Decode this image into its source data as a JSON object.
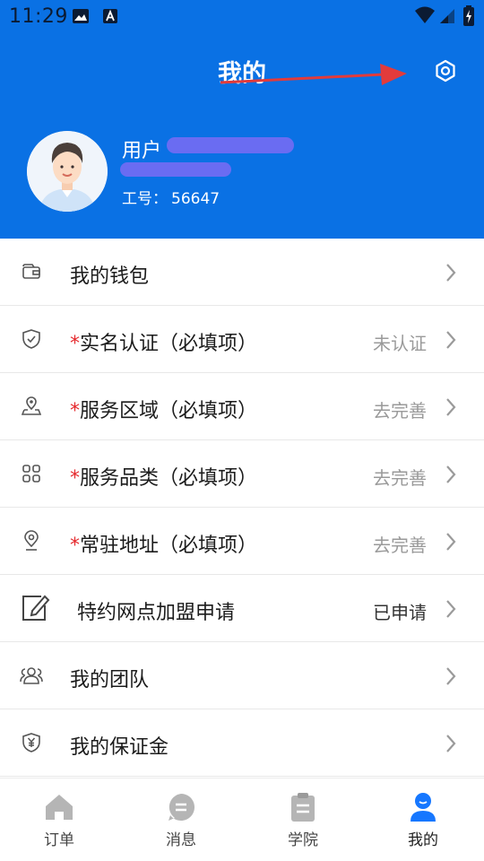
{
  "status_bar": {
    "time": "11:29"
  },
  "header": {
    "title": "我的"
  },
  "profile": {
    "name_prefix": "用户",
    "staff_id_label": "工号：",
    "staff_id": "56647"
  },
  "menu": {
    "required_mark": "*",
    "items": [
      {
        "label": "我的钱包",
        "required": false,
        "status": "",
        "icon": "wallet-icon"
      },
      {
        "label": "实名认证（必填项）",
        "required": true,
        "status": "未认证",
        "icon": "shield-check-icon"
      },
      {
        "label": "服务区域（必填项）",
        "required": true,
        "status": "去完善",
        "icon": "map-pin-area-icon"
      },
      {
        "label": "服务品类（必填项）",
        "required": true,
        "status": "去完善",
        "icon": "category-grid-icon"
      },
      {
        "label": "常驻地址（必填项）",
        "required": true,
        "status": "去完善",
        "icon": "location-pin-icon"
      },
      {
        "label": "特约网点加盟申请",
        "required": false,
        "status": "已申请",
        "icon": "edit-form-icon"
      },
      {
        "label": "我的团队",
        "required": false,
        "status": "",
        "icon": "team-icon"
      },
      {
        "label": "我的保证金",
        "required": false,
        "status": "",
        "icon": "deposit-shield-icon"
      }
    ]
  },
  "tabbar": {
    "tabs": [
      {
        "label": "订单",
        "icon": "home-icon",
        "active": false
      },
      {
        "label": "消息",
        "icon": "message-icon",
        "active": false
      },
      {
        "label": "学院",
        "icon": "clipboard-icon",
        "active": false
      },
      {
        "label": "我的",
        "icon": "user-icon",
        "active": true
      }
    ]
  },
  "colors": {
    "header_blue": "#0a71e4",
    "required_red": "#e5282c",
    "status_gray": "#9a9a9a",
    "active_tab_blue": "#1677ff",
    "inactive_tab_gray": "#b5b5b5",
    "annotation_red": "#e23b3b"
  }
}
